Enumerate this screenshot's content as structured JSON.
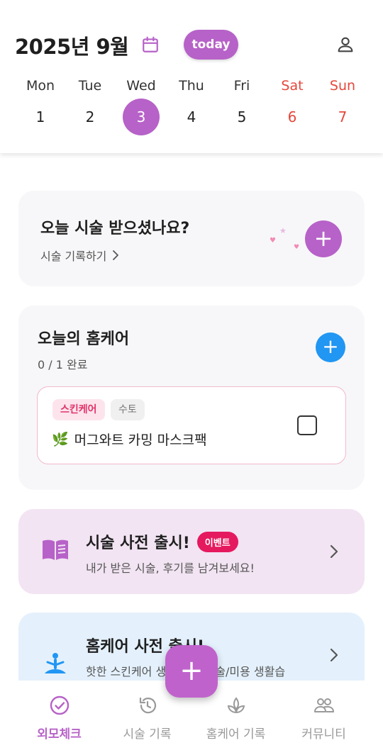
{
  "header": {
    "month_title": "2025년 9월",
    "today_label": "today",
    "week": [
      {
        "name": "Mon",
        "num": "1"
      },
      {
        "name": "Tue",
        "num": "2"
      },
      {
        "name": "Wed",
        "num": "3"
      },
      {
        "name": "Thu",
        "num": "4"
      },
      {
        "name": "Fri",
        "num": "5"
      },
      {
        "name": "Sat",
        "num": "6"
      },
      {
        "name": "Sun",
        "num": "7"
      }
    ]
  },
  "record_card": {
    "title": "오늘 시술 받으셨나요?",
    "link": "시술 기록하기"
  },
  "homecare": {
    "title": "오늘의 홈케어",
    "progress": "0 / 1 완료",
    "task": {
      "tag_category": "스킨케어",
      "tag_day": "수토",
      "name": "머그와트 카밍 마스크팩",
      "emoji": "🌿"
    }
  },
  "banners": {
    "dictionary": {
      "title": "시술 사전 출시!",
      "badge": "이벤트",
      "subtitle": "내가 받은 시술, 후기를 남겨보세요!"
    },
    "homecare_dictionary": {
      "title": "홈케어 사전 출시!",
      "subtitle": "핫한 스킨케어 생활 관리 기술/미용 생활습"
    }
  },
  "bottom_nav": [
    {
      "label": "외모체크",
      "active": true
    },
    {
      "label": "시술 기록",
      "active": false
    },
    {
      "label": "홈케어 기록",
      "active": false
    },
    {
      "label": "커뮤니티",
      "active": false
    }
  ],
  "colors": {
    "accent": "#b762c8",
    "weekend": "#e5483c",
    "blue": "#2196f3",
    "event_badge": "#e5195e"
  },
  "icons": {
    "calendar": "calendar-icon",
    "profile": "person-icon",
    "book": "book-icon",
    "meditation": "meditation-icon",
    "check_circle": "check-circle-icon",
    "history": "history-icon",
    "plant": "plant-icon",
    "people": "people-icon"
  }
}
